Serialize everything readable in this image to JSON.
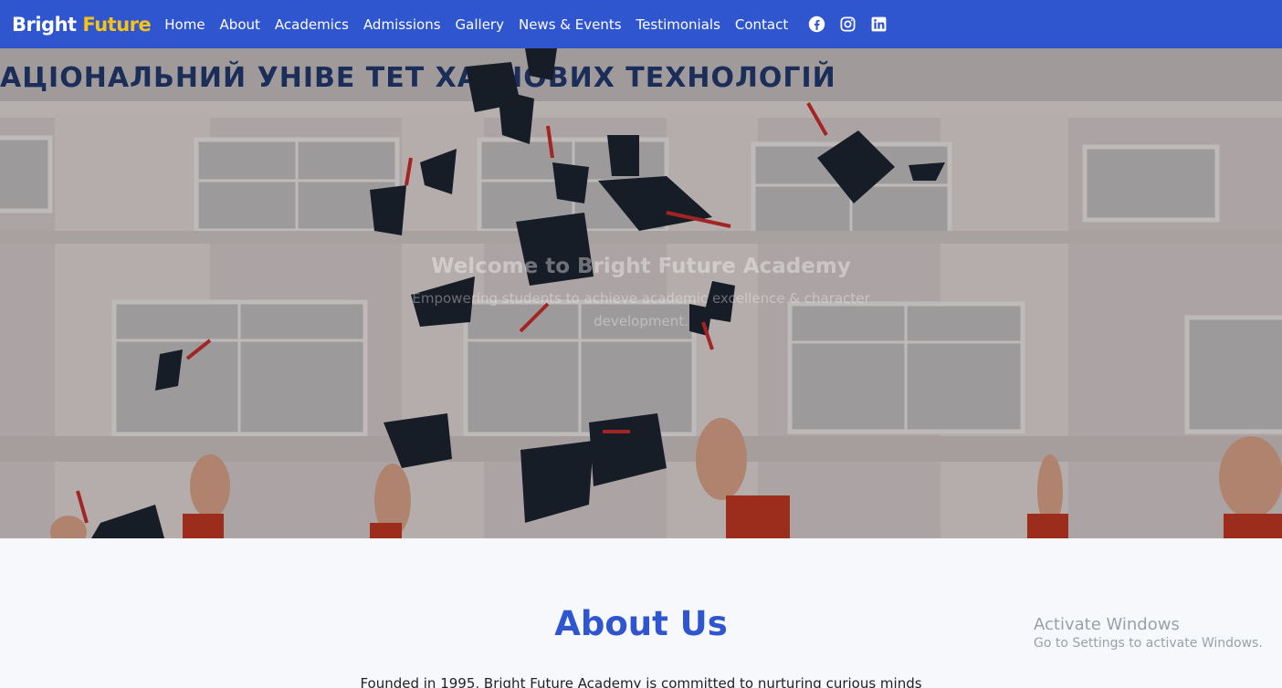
{
  "brand": {
    "part1": "Bright",
    "part2": "Future"
  },
  "nav": {
    "items": [
      {
        "label": "Home"
      },
      {
        "label": "About"
      },
      {
        "label": "Academics"
      },
      {
        "label": "Admissions"
      },
      {
        "label": "Gallery"
      },
      {
        "label": "News & Events"
      },
      {
        "label": "Testimonials"
      },
      {
        "label": "Contact"
      }
    ],
    "socials": [
      "facebook-icon",
      "instagram-icon",
      "linkedin-icon"
    ]
  },
  "hero": {
    "title": "Welcome to Bright Future Academy",
    "subtitle": "Empowering students to achieve academic excellence & character development.",
    "building_sign": "АЦІОНАЛЬНИЙ УНІВЕ  ТЕТ ХАРЧОВИХ ТЕХНОЛОГІЙ"
  },
  "about": {
    "title": "About Us",
    "text": "Founded in 1995, Bright Future Academy is committed to nurturing curious minds"
  },
  "watermark": {
    "line1": "Activate Windows",
    "line2": "Go to Settings to activate Windows."
  },
  "colors": {
    "primary": "#2f55cf",
    "accent": "#f7c315"
  }
}
